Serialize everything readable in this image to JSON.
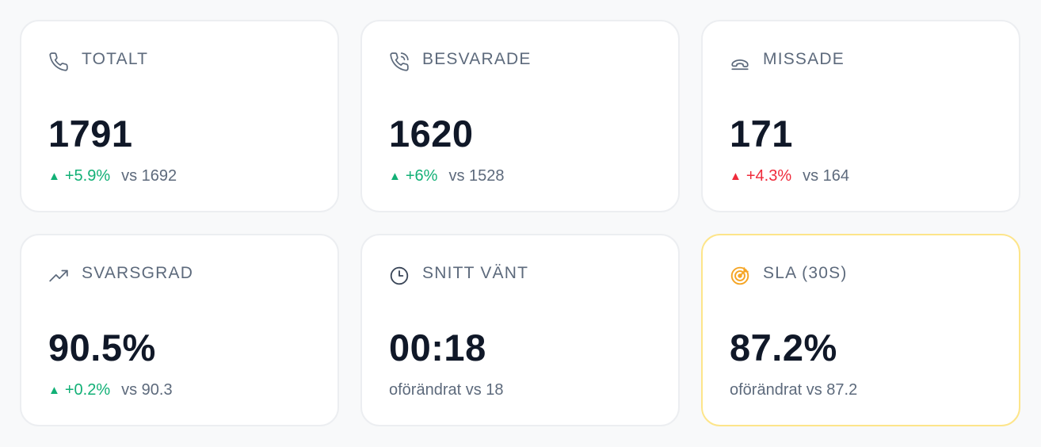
{
  "colors": {
    "good": "#12b076",
    "bad": "#ef2b3b",
    "sla_accent": "#f5a524",
    "sla_border": "#fde58a"
  },
  "cards": [
    {
      "label": "TOTALT",
      "icon": "phone-icon",
      "value": "1791",
      "triangle": "▲",
      "change": "+5.9%",
      "vs": "vs 1692"
    },
    {
      "label": "BESVARADE",
      "icon": "phone-incoming-icon",
      "value": "1620",
      "triangle": "▲",
      "change": "+6%",
      "vs": "vs 1528"
    },
    {
      "label": "MISSADE",
      "icon": "phone-hangup-icon",
      "value": "171",
      "triangle": "▲",
      "change": "+4.3%",
      "vs": "vs 164"
    },
    {
      "label": "SVARSGRAD",
      "icon": "trending-up-icon",
      "value": "90.5%",
      "triangle": "▲",
      "change": "+0.2%",
      "vs": "vs 90.3"
    },
    {
      "label": "SNITT VÄNT",
      "icon": "clock-icon",
      "value": "00:18",
      "unchanged": "oförändrat vs 18"
    },
    {
      "label": "SLA (30S)",
      "icon": "target-icon",
      "value": "87.2%",
      "unchanged": "oförändrat vs 87.2"
    }
  ]
}
